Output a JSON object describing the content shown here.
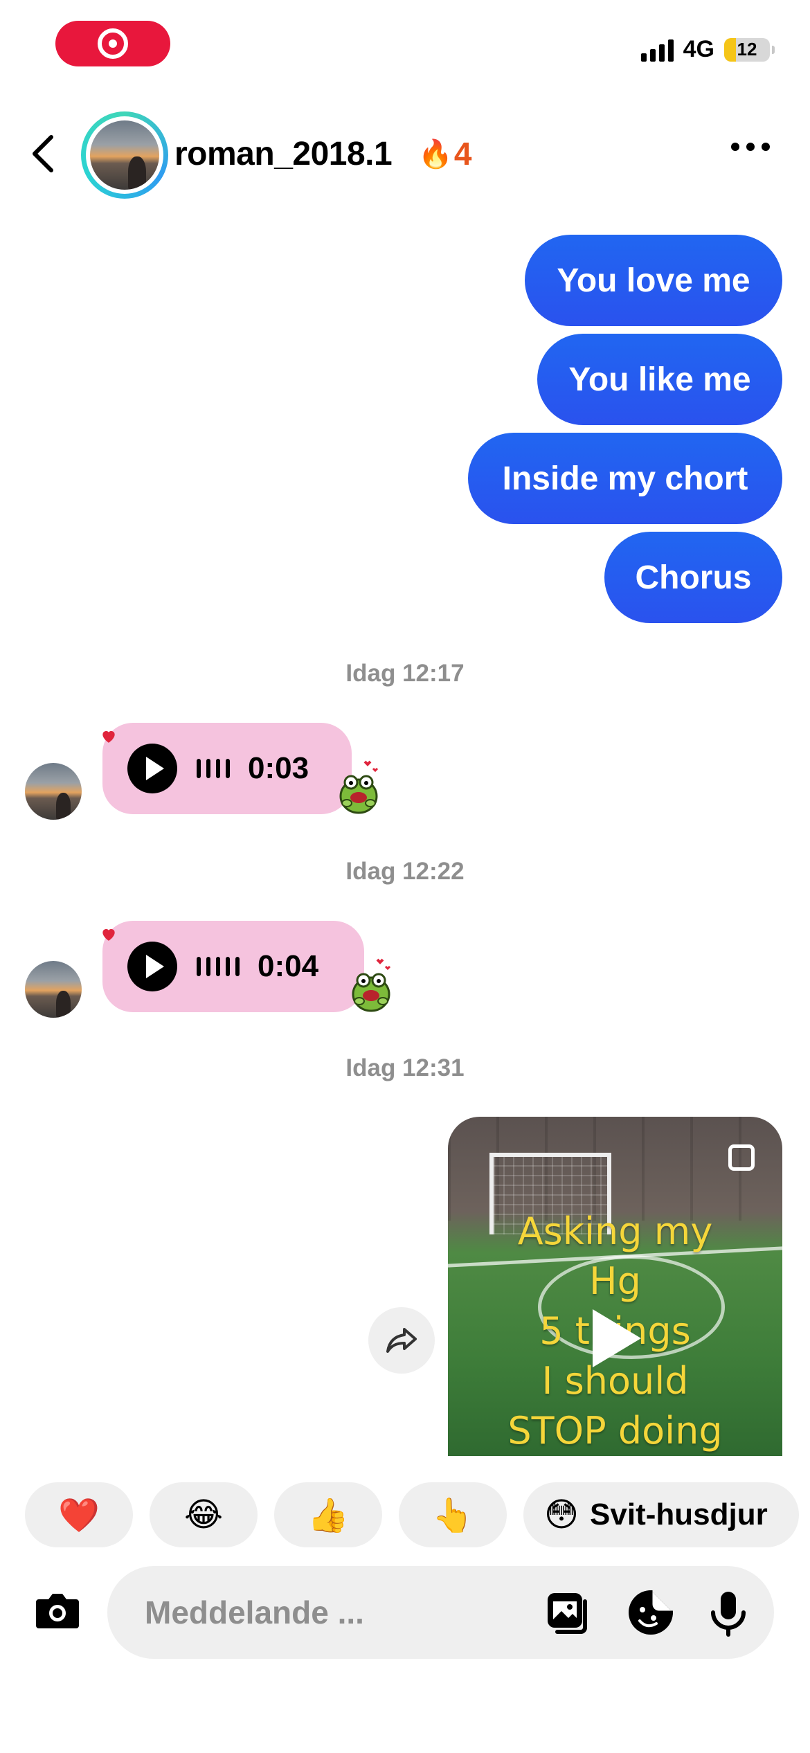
{
  "status_bar": {
    "network": "4G",
    "battery_level": "12",
    "battery_fraction": 0.12,
    "recording_indicator_color": "#e8173c"
  },
  "header": {
    "username": "roman_2018.1",
    "streak_icon": "fire-emoji",
    "streak_emoji": "🔥",
    "streak_count": "4",
    "story_ring_colors": [
      "#3fd6b8",
      "#2e9cf0"
    ]
  },
  "messages_sent": [
    {
      "text": "You love me"
    },
    {
      "text": "You like me"
    },
    {
      "text": "Inside my chort"
    },
    {
      "text": "Chorus"
    }
  ],
  "timestamps": [
    "Idag 12:17",
    "Idag 12:22",
    "Idag 12:31"
  ],
  "voice_messages": [
    {
      "duration": "0:03",
      "reaction": "heart",
      "sticker": "frog-hearts-sticker"
    },
    {
      "duration": "0:04",
      "reaction": "heart",
      "sticker": "frog-hearts-sticker"
    }
  ],
  "video_message": {
    "caption_lines": [
      "Asking my",
      "Hg",
      "5 things",
      "I should",
      "STOP doing"
    ]
  },
  "quick_replies": [
    {
      "emoji": "❤️"
    },
    {
      "emoji": "😂"
    },
    {
      "emoji": "👍"
    },
    {
      "emoji": "👆"
    },
    {
      "emoji": "😳",
      "label": "Svit-husdjur"
    }
  ],
  "composer": {
    "placeholder": "Meddelande ...",
    "value": ""
  },
  "colors": {
    "sent_bubble": "#2166f1",
    "voice_bubble": "#f5c3de",
    "timestamp": "#8e8e8e",
    "streak": "#e8551c"
  }
}
